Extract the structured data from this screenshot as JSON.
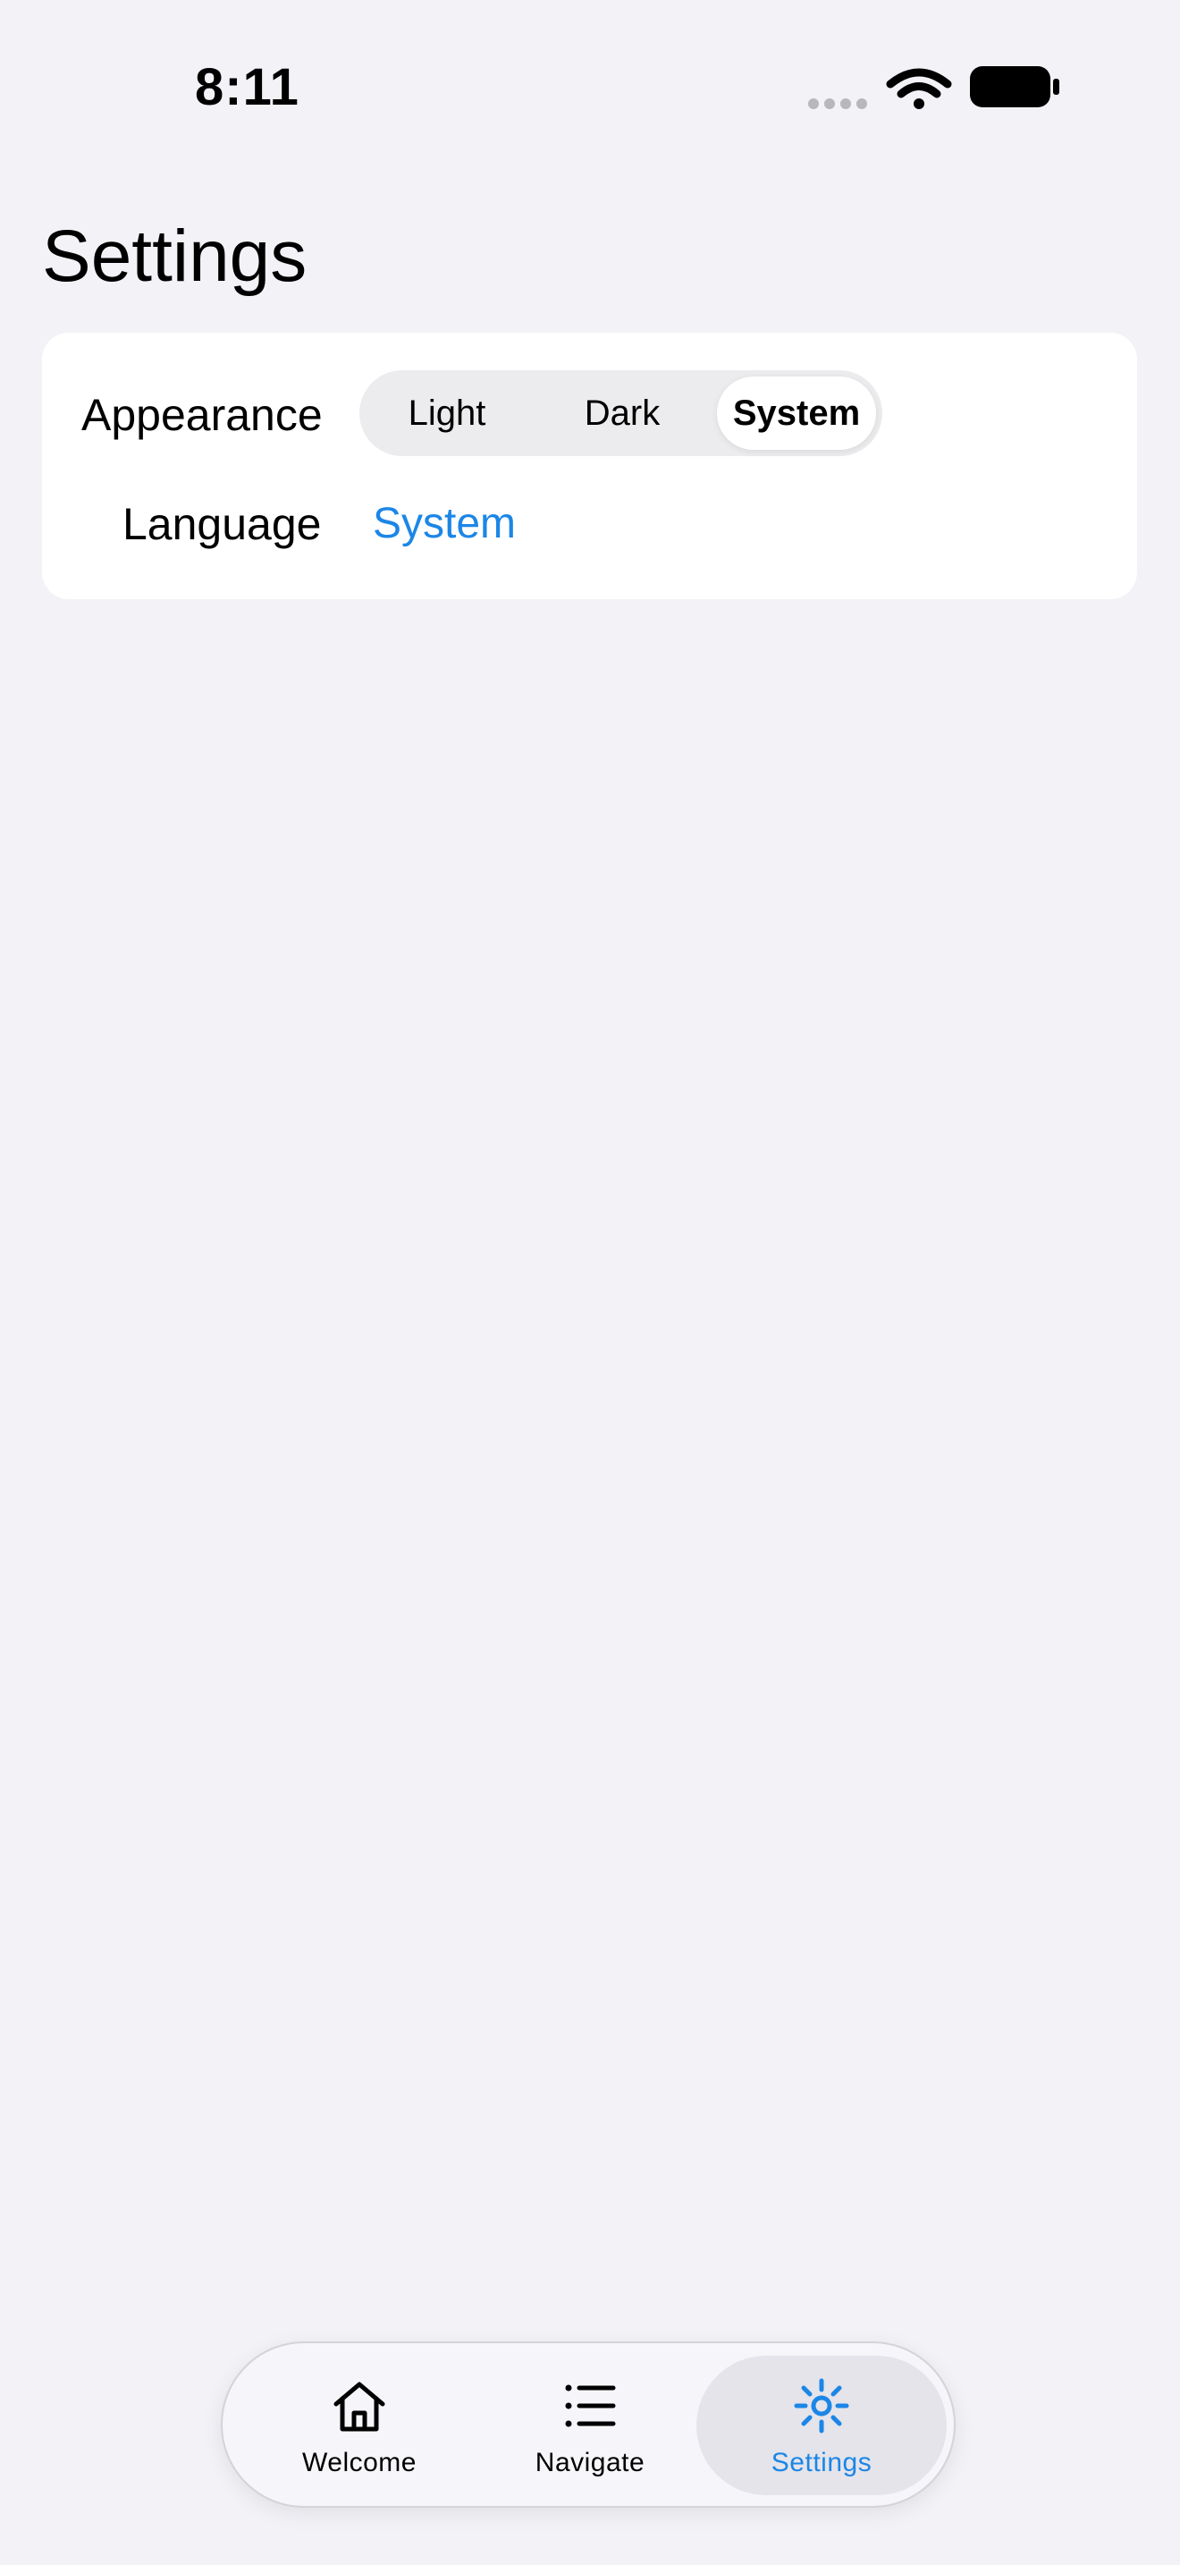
{
  "status_bar": {
    "time": "8:11"
  },
  "page": {
    "title": "Settings"
  },
  "settings": {
    "appearance_label": "Appearance",
    "appearance_options": [
      "Light",
      "Dark",
      "System"
    ],
    "appearance_selected": "System",
    "language_label": "Language",
    "language_value": "System"
  },
  "tab_bar": {
    "tabs": [
      {
        "label": "Welcome",
        "icon": "house-icon"
      },
      {
        "label": "Navigate",
        "icon": "list-icon"
      },
      {
        "label": "Settings",
        "icon": "sun-gear-icon"
      }
    ],
    "active": "Settings"
  },
  "colors": {
    "accent": "#1c86e6",
    "background": "#f2f2f7",
    "card": "#ffffff"
  }
}
